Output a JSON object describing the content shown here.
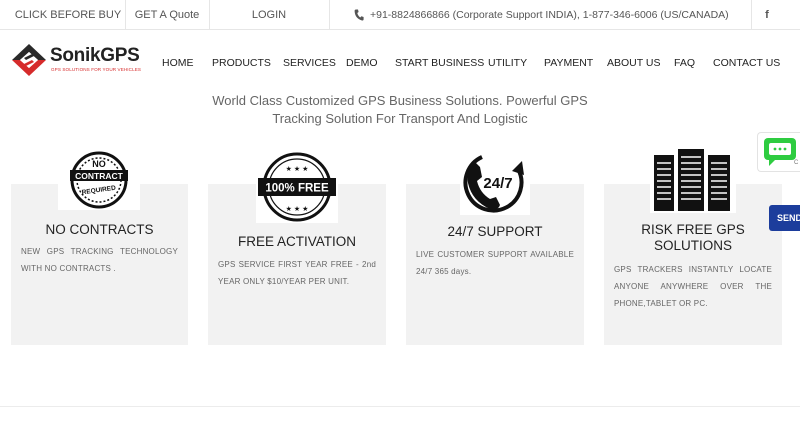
{
  "topbar": {
    "click_before_buy": "CLICK BEFORE BUY",
    "get_quote": "GET A Quote",
    "login": "LOGIN",
    "phone_text": "+91-8824866866 (Corporate Support INDIA), 1-877-346-6006 (US/CANADA)",
    "facebook": "f"
  },
  "logo": {
    "name": "SonikGPS",
    "tagline": "GPS SOLUTIONS FOR YOUR VEHICLES"
  },
  "nav": {
    "items": [
      "HOME",
      "PRODUCTS",
      "SERVICES",
      "DEMO",
      "START BUSINESS",
      "UTILITY",
      "PAYMENT",
      "ABOUT US",
      "FAQ",
      "CONTACT US"
    ]
  },
  "hero": {
    "tagline": "World Class Customized GPS Business Solutions. Powerful GPS Tracking Solution For Transport And Logistic"
  },
  "features": [
    {
      "icon": "no-contract-required-badge",
      "badge_lines": [
        "NO",
        "CONTRACT",
        "REQUIRED"
      ],
      "title": "NO CONTRACTS",
      "desc": "NEW GPS TRACKING TECHNOLOGY WITH NO CONTRACTS ."
    },
    {
      "icon": "100-percent-free-badge",
      "badge_text": "100% FREE",
      "title": "FREE ACTIVATION",
      "desc": "GPS SERVICE FIRST YEAR FREE - 2nd YEAR ONLY $10/YEAR PER UNIT."
    },
    {
      "icon": "24-7-phone-icon",
      "badge_text": "24/7",
      "title": "24/7 SUPPORT",
      "desc": "LIVE CUSTOMER SUPPORT AVAILABLE 24/7 365 days."
    },
    {
      "icon": "server-rack-icon",
      "title": "RISK FREE GPS SOLUTIONS",
      "desc": "GPS TRACKERS INSTANTLY LOCATE ANYONE ANYWHERE OVER THE PHONE,TABLET OR PC."
    }
  ],
  "floaters": {
    "chat_letter": "C",
    "send_label": "SEND"
  },
  "colors": {
    "card_bg": "#f2f2f2",
    "logo_red": "#d62b2b",
    "chat_green": "#2ecc40",
    "send_blue": "#1c3d9c"
  }
}
